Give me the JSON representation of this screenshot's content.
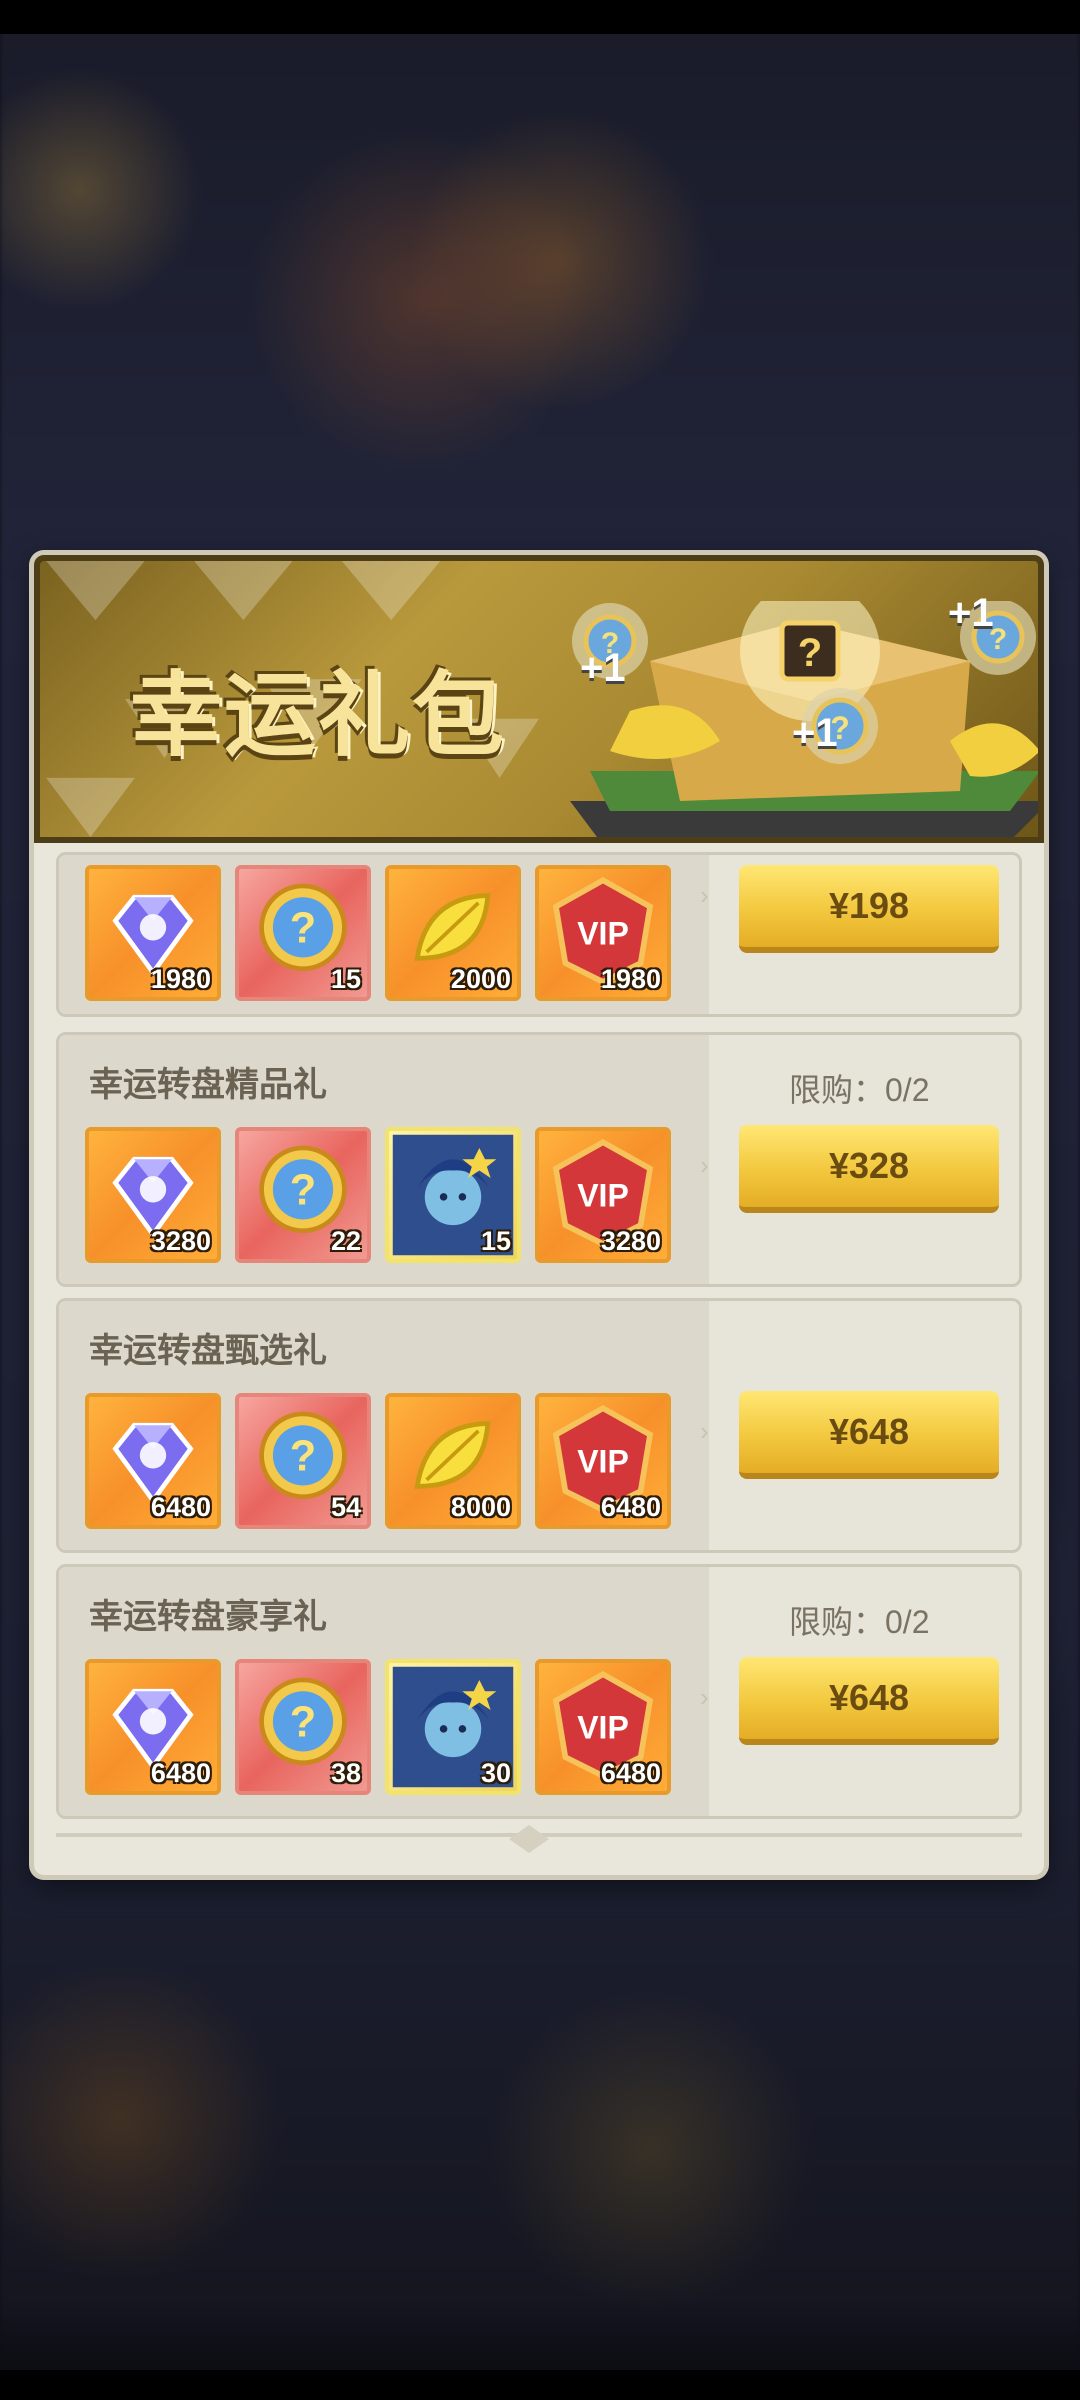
{
  "banner": {
    "title": "幸运礼包",
    "plus_labels": [
      "+1",
      "+1",
      "+1"
    ]
  },
  "packs": [
    {
      "title": "",
      "limit": "",
      "price": "¥198",
      "items": [
        {
          "icon": "diamond-icon",
          "qty": "1980",
          "bg": "orange"
        },
        {
          "icon": "mystery-coin-icon",
          "qty": "15",
          "bg": "red"
        },
        {
          "icon": "gold-leaf-icon",
          "qty": "2000",
          "bg": "orange"
        },
        {
          "icon": "vip-badge-icon",
          "qty": "1980",
          "bg": "orange"
        }
      ]
    },
    {
      "title": "幸运转盘精品礼",
      "limit": "限购：0/2",
      "price": "¥328",
      "items": [
        {
          "icon": "diamond-icon",
          "qty": "3280",
          "bg": "orange"
        },
        {
          "icon": "mystery-coin-icon",
          "qty": "22",
          "bg": "red"
        },
        {
          "icon": "hero-portrait-icon",
          "qty": "15",
          "bg": "hero"
        },
        {
          "icon": "vip-badge-icon",
          "qty": "3280",
          "bg": "orange"
        }
      ]
    },
    {
      "title": "幸运转盘甄选礼",
      "limit": "",
      "price": "¥648",
      "items": [
        {
          "icon": "diamond-icon",
          "qty": "6480",
          "bg": "orange"
        },
        {
          "icon": "mystery-coin-icon",
          "qty": "54",
          "bg": "red"
        },
        {
          "icon": "gold-leaf-icon",
          "qty": "8000",
          "bg": "orange"
        },
        {
          "icon": "vip-badge-icon",
          "qty": "6480",
          "bg": "orange"
        }
      ]
    },
    {
      "title": "幸运转盘豪享礼",
      "limit": "限购：0/2",
      "price": "¥648",
      "items": [
        {
          "icon": "diamond-icon",
          "qty": "6480",
          "bg": "orange"
        },
        {
          "icon": "mystery-coin-icon",
          "qty": "38",
          "bg": "red"
        },
        {
          "icon": "hero-portrait-icon",
          "qty": "30",
          "bg": "hero"
        },
        {
          "icon": "vip-badge-icon",
          "qty": "6480",
          "bg": "orange"
        }
      ]
    }
  ],
  "icon_text": {
    "question_mark": "?",
    "vip": "VIP"
  }
}
